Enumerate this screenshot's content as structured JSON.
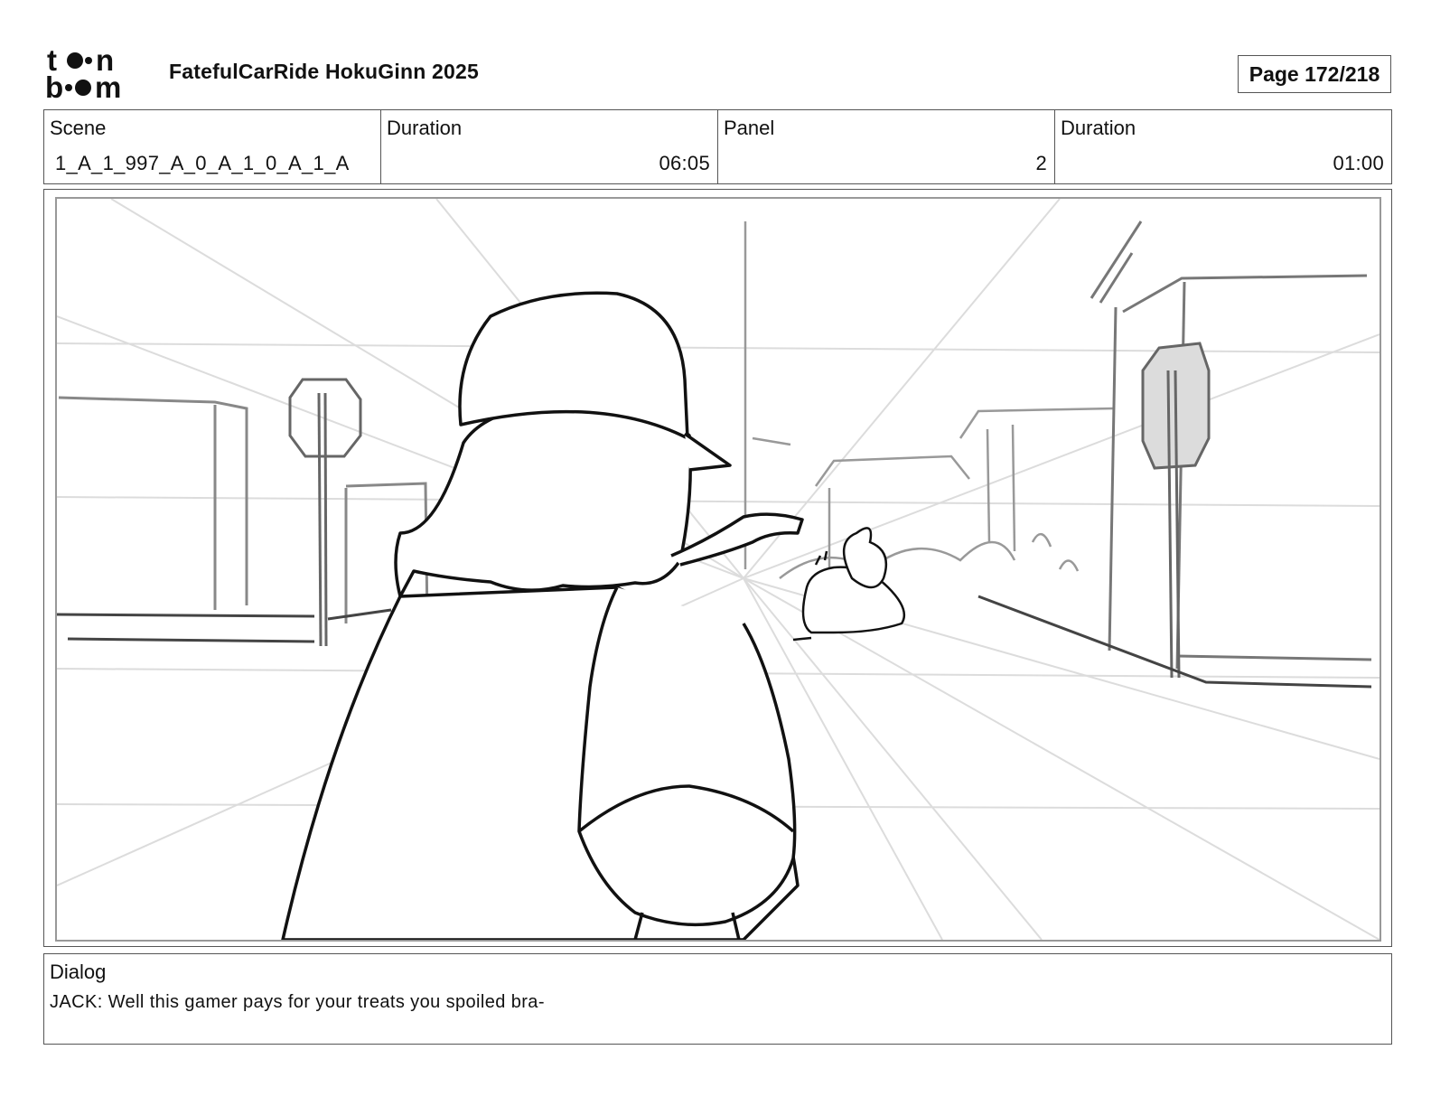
{
  "header": {
    "logo_text_top": "toon",
    "logo_text_bottom": "boom",
    "title": "FatefulCarRide HokuGinn 2025",
    "page": "Page 172/218"
  },
  "info": {
    "scene_label": "Scene",
    "scene_value": "1_A_1_997_A_0_A_1_0_A_1_A",
    "scene_duration_label": "Duration",
    "scene_duration_value": "06:05",
    "panel_label": "Panel",
    "panel_value": "2",
    "panel_duration_label": "Duration",
    "panel_duration_value": "01:00"
  },
  "dialog": {
    "label": "Dialog",
    "text": "JACK: Well this gamer pays for your treats you spoiled bra-"
  }
}
